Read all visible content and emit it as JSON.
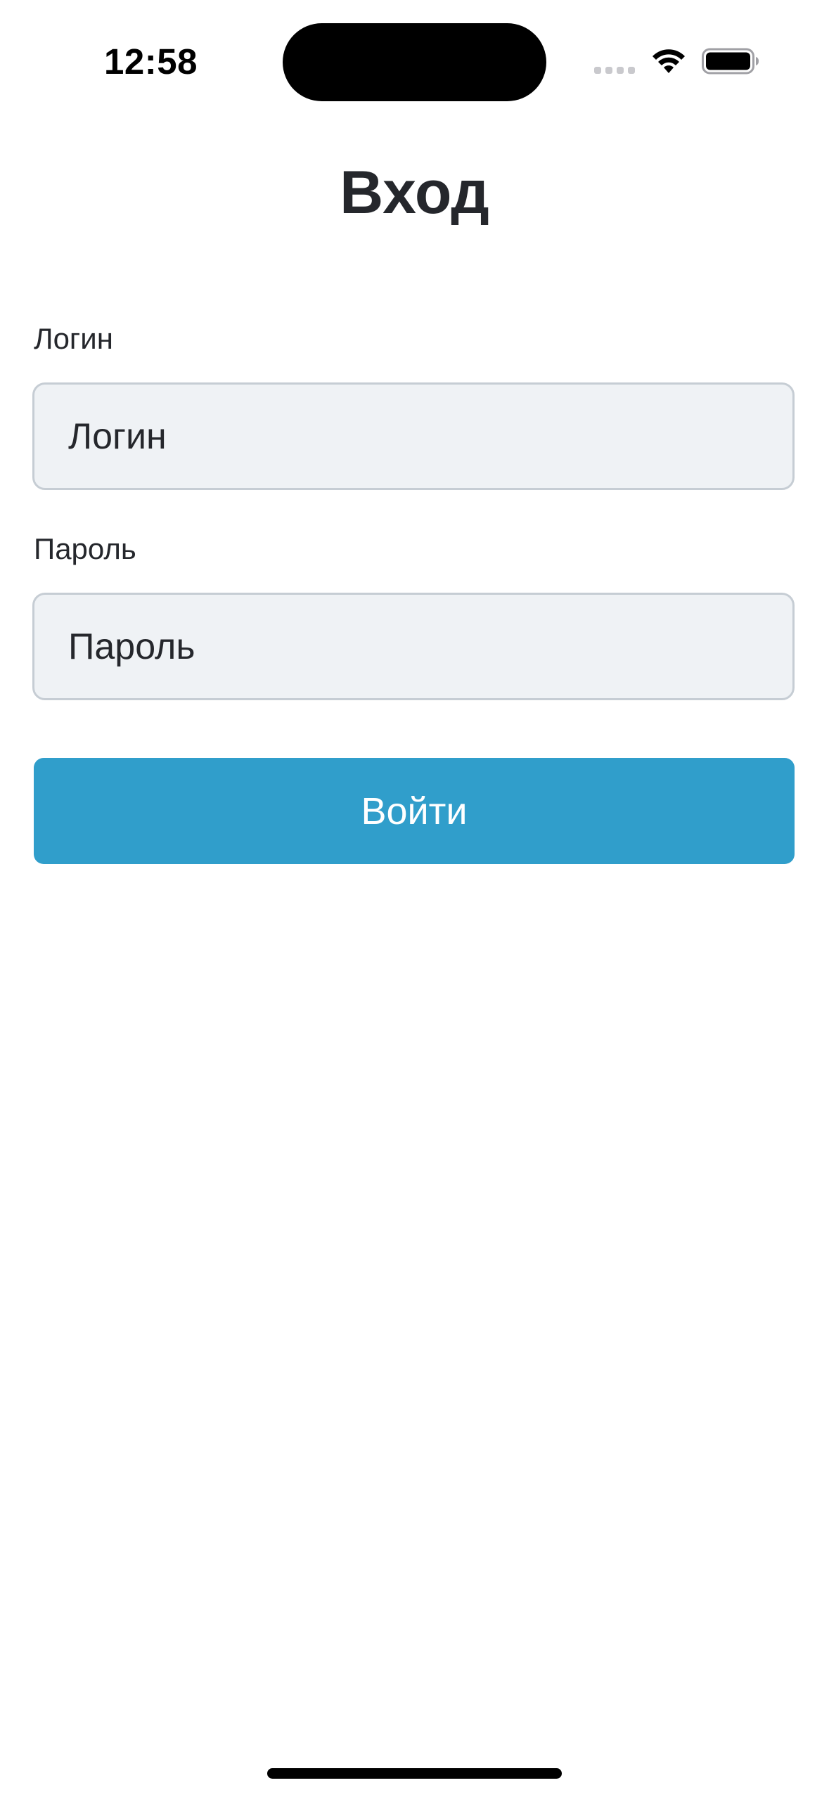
{
  "status_bar": {
    "time": "12:58",
    "icons": [
      "signal-icon",
      "wifi-icon",
      "battery-icon"
    ]
  },
  "page": {
    "title": "Вход"
  },
  "form": {
    "login": {
      "label": "Логин",
      "placeholder": "Логин",
      "value": ""
    },
    "password": {
      "label": "Пароль",
      "placeholder": "Пароль",
      "value": ""
    },
    "submit_label": "Войти"
  },
  "colors": {
    "accent": "#309ecb",
    "input_background": "#eff2f5",
    "input_border": "#c6cdd4",
    "text": "#25272c",
    "background": "#ffffff"
  }
}
